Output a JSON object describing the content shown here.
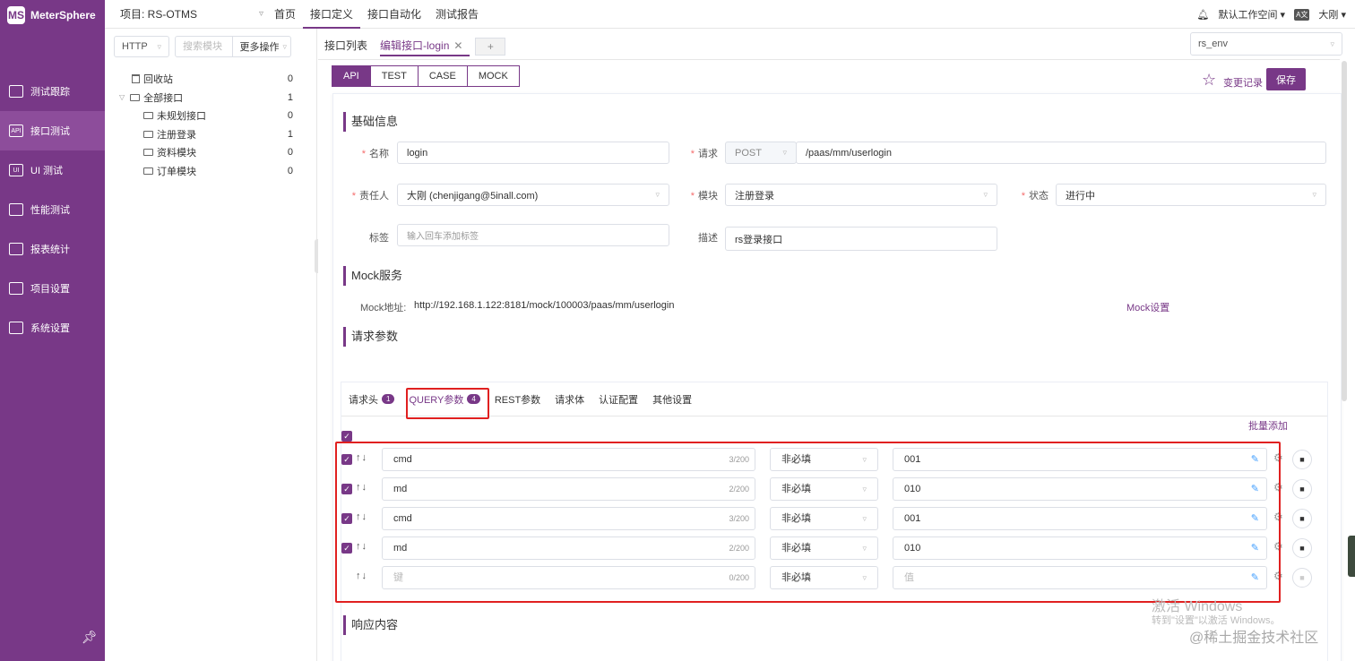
{
  "app": {
    "logo_text": "MeterSphere"
  },
  "colors": {
    "brand": "#783887",
    "highlight": "#e02020"
  },
  "nav": {
    "items": [
      {
        "label": "测试跟踪",
        "icon": "clipboard-icon",
        "active": false
      },
      {
        "label": "接口测试",
        "icon": "api-icon",
        "active": true
      },
      {
        "label": "UI 测试",
        "icon": "ui-icon",
        "active": false
      },
      {
        "label": "性能测试",
        "icon": "chart-icon",
        "active": false
      },
      {
        "label": "报表统计",
        "icon": "report-icon",
        "active": false
      },
      {
        "label": "项目设置",
        "icon": "folder-icon",
        "active": false
      },
      {
        "label": "系统设置",
        "icon": "gear-icon",
        "active": false
      }
    ]
  },
  "header": {
    "project": "项目: RS-OTMS",
    "menu": [
      "首页",
      "接口定义",
      "接口自动化",
      "测试报告"
    ],
    "active_menu": "接口定义",
    "workspace": "默认工作空间",
    "user": "大刚"
  },
  "tree": {
    "protocol": "HTTP",
    "search_placeholder": "搜索模块",
    "more": "更多操作",
    "items": [
      {
        "label": "回收站",
        "count": "0",
        "icon": "trash-icon",
        "indent": 1
      },
      {
        "label": "全部接口",
        "count": "1",
        "icon": "folder-icon",
        "indent": 0
      },
      {
        "label": "未规划接口",
        "count": "0",
        "icon": "folder-icon",
        "indent": 2
      },
      {
        "label": "注册登录",
        "count": "1",
        "icon": "folder-icon",
        "indent": 2
      },
      {
        "label": "资料模块",
        "count": "0",
        "icon": "folder-icon",
        "indent": 2
      },
      {
        "label": "订单模块",
        "count": "0",
        "icon": "folder-icon",
        "indent": 2
      }
    ]
  },
  "tabs": {
    "list": "接口列表",
    "edit": "编辑接口-login",
    "add": "+"
  },
  "env": "rs_env",
  "modes": [
    "API",
    "TEST",
    "CASE",
    "MOCK"
  ],
  "actions": {
    "history": "变更记录",
    "save": "保存"
  },
  "basic": {
    "title": "基础信息",
    "name_label": "名称",
    "name": "login",
    "request_label": "请求",
    "method": "POST",
    "path": "/paas/mm/userlogin",
    "owner_label": "责任人",
    "owner": "大刚 (chenjigang@5inall.com)",
    "module_label": "模块",
    "module": "注册登录",
    "status_label": "状态",
    "status": "进行中",
    "tag_label": "标签",
    "tag_placeholder": "输入回车添加标签",
    "desc_label": "描述",
    "desc": "rs登录接口"
  },
  "mock": {
    "title": "Mock服务",
    "addr_label": "Mock地址:",
    "addr": "http://192.168.1.122:8181/mock/100003/paas/mm/userlogin",
    "settings": "Mock设置"
  },
  "params": {
    "title": "请求参数",
    "tabs": [
      {
        "label": "请求头",
        "badge": "1"
      },
      {
        "label": "QUERY参数",
        "badge": "4"
      },
      {
        "label": "REST参数",
        "badge": ""
      },
      {
        "label": "请求体",
        "badge": ""
      },
      {
        "label": "认证配置",
        "badge": ""
      },
      {
        "label": "其他设置",
        "badge": ""
      }
    ],
    "batch_add": "批量添加",
    "rows": [
      {
        "checked": true,
        "key": "cmd",
        "len": "3/200",
        "required": "非必填",
        "value": "001"
      },
      {
        "checked": true,
        "key": "md",
        "len": "2/200",
        "required": "非必填",
        "value": "010"
      },
      {
        "checked": true,
        "key": "cmd",
        "len": "3/200",
        "required": "非必填",
        "value": "001"
      },
      {
        "checked": true,
        "key": "md",
        "len": "2/200",
        "required": "非必填",
        "value": "010"
      },
      {
        "checked": false,
        "key": "键",
        "len": "0/200",
        "required": "非必填",
        "value": "值",
        "placeholder": true
      }
    ]
  },
  "response": {
    "title": "响应内容"
  },
  "watermark": {
    "line1": "激活 Windows",
    "line2": "转到\"设置\"以激活 Windows。",
    "site": "@稀土掘金技术社区"
  }
}
